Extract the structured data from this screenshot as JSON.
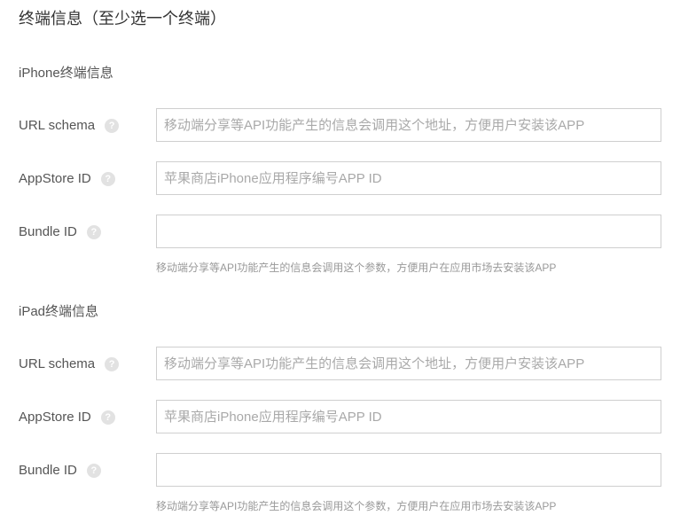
{
  "section_title": "终端信息（至少选一个终端）",
  "iphone": {
    "title": "iPhone终端信息",
    "url_schema": {
      "label": "URL schema",
      "value": "",
      "placeholder": "移动端分享等API功能产生的信息会调用这个地址，方便用户安装该APP"
    },
    "appstore_id": {
      "label": "AppStore ID",
      "value": "",
      "placeholder": "苹果商店iPhone应用程序编号APP ID"
    },
    "bundle_id": {
      "label": "Bundle ID",
      "value": "",
      "placeholder": ""
    },
    "bundle_hint": "移动端分享等API功能产生的信息会调用这个参数，方便用户在应用市场去安装该APP"
  },
  "ipad": {
    "title": "iPad终端信息",
    "url_schema": {
      "label": "URL schema",
      "value": "",
      "placeholder": "移动端分享等API功能产生的信息会调用这个地址，方便用户安装该APP"
    },
    "appstore_id": {
      "label": "AppStore ID",
      "value": "",
      "placeholder": "苹果商店iPhone应用程序编号APP ID"
    },
    "bundle_id": {
      "label": "Bundle ID",
      "value": "",
      "placeholder": ""
    },
    "bundle_hint": "移动端分享等API功能产生的信息会调用这个参数，方便用户在应用市场去安装该APP"
  },
  "help_icon_glyph": "?",
  "colors": {
    "border": "#cfcfcf",
    "placeholder": "#a9a9a9",
    "help_icon": "#e2e2e2",
    "hint": "#999999"
  }
}
